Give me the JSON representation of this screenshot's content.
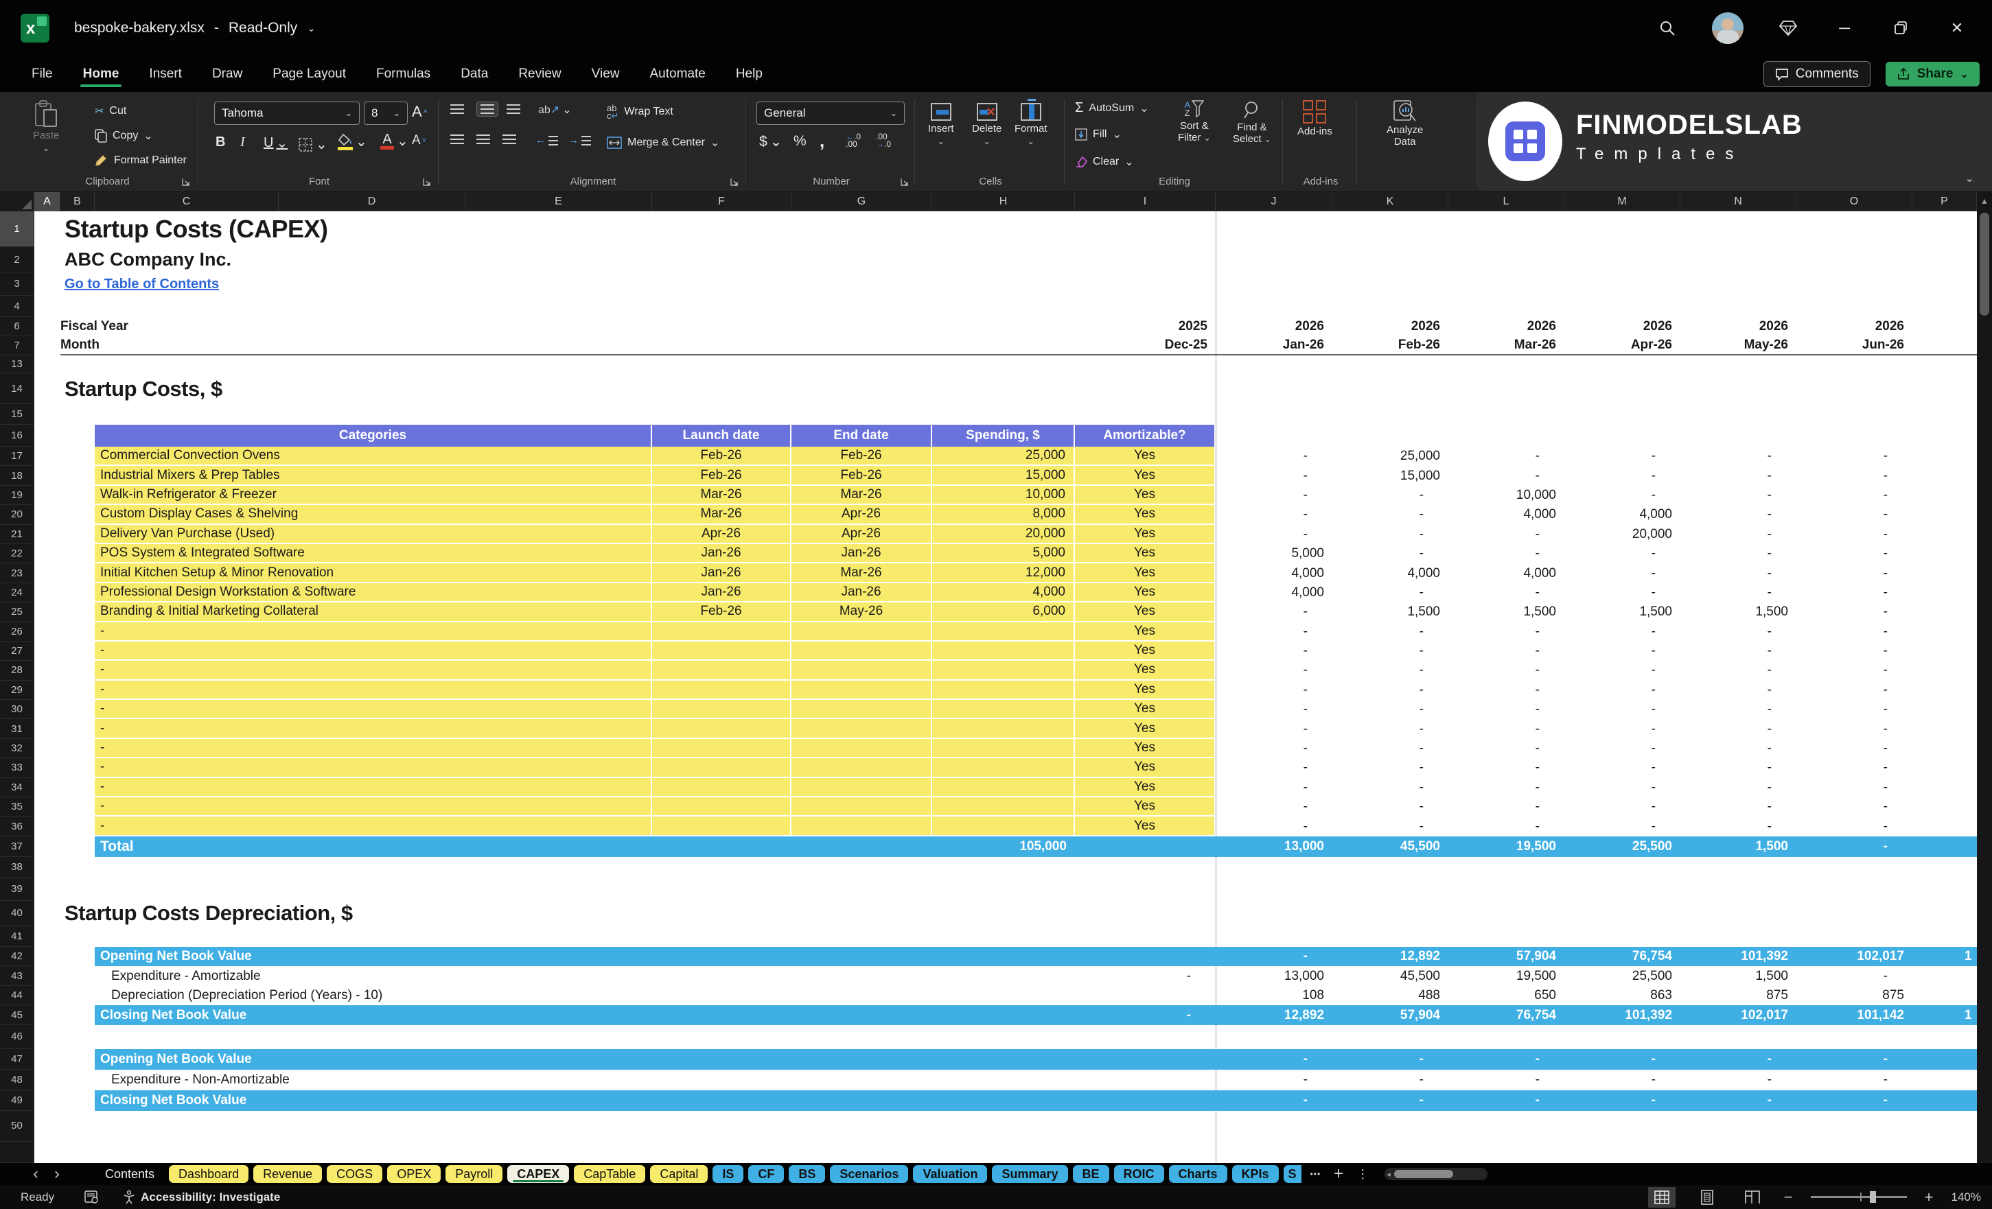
{
  "titlebar": {
    "file": "bespoke-bakery.xlsx",
    "dash": "-",
    "mode": "Read-Only"
  },
  "menu": {
    "tabs": [
      "File",
      "Home",
      "Insert",
      "Draw",
      "Page Layout",
      "Formulas",
      "Data",
      "Review",
      "View",
      "Automate",
      "Help"
    ],
    "active_index": 1,
    "comments": "Comments",
    "share": "Share"
  },
  "ribbon": {
    "clipboard": {
      "paste": "Paste",
      "cut": "Cut",
      "copy": "Copy",
      "format_painter": "Format Painter",
      "label": "Clipboard"
    },
    "font": {
      "family": "Tahoma",
      "size": "8",
      "bold": "B",
      "italic": "I",
      "underline": "U",
      "label": "Font"
    },
    "alignment": {
      "wrap": "Wrap Text",
      "merge": "Merge & Center",
      "label": "Alignment"
    },
    "number": {
      "format": "General",
      "label": "Number"
    },
    "cells": {
      "insert": "Insert",
      "delete": "Delete",
      "format": "Format",
      "label": "Cells"
    },
    "editing": {
      "autosum": "AutoSum",
      "fill": "Fill",
      "clear": "Clear",
      "sort1": "Sort &",
      "sort2": "Filter",
      "find1": "Find &",
      "find2": "Select",
      "label": "Editing"
    },
    "addins": {
      "button": "Add-ins",
      "label": "Add-ins",
      "analyze1": "Analyze",
      "analyze2": "Data"
    },
    "brand": {
      "name": "FINMODELSLAB",
      "sub": "Templates"
    }
  },
  "sheet": {
    "columns": [
      "A",
      "B",
      "C",
      "D",
      "E",
      "F",
      "G",
      "H",
      "I",
      "J",
      "K",
      "L",
      "M",
      "N",
      "O",
      "P"
    ],
    "selected_column": "A",
    "table_headers": [
      "Categories",
      "Launch date",
      "End date",
      "Spending, $",
      "Amortizable?"
    ],
    "grid_rows": [
      {
        "n": "1",
        "type": "title",
        "text": "Startup Costs (CAPEX)",
        "h": 52
      },
      {
        "n": "2",
        "type": "company",
        "text": "ABC Company Inc.",
        "h": 37
      },
      {
        "n": "3",
        "type": "link",
        "text": "Go to Table of Contents",
        "h": 34
      },
      {
        "n": "4",
        "type": "blank",
        "h": 31
      },
      {
        "n": "6",
        "type": "fiscal",
        "label": "Fiscal Year",
        "vals": [
          "2025",
          "2026",
          "2026",
          "2026",
          "2026",
          "2026",
          "2026"
        ],
        "h": 28
      },
      {
        "n": "7",
        "type": "fiscal",
        "label": "Month",
        "vals": [
          "Dec-25",
          "Jan-26",
          "Feb-26",
          "Mar-26",
          "Apr-26",
          "May-26",
          "Jun-26"
        ],
        "h": 28,
        "border": true
      },
      {
        "n": "13",
        "type": "blank",
        "h": 26
      },
      {
        "n": "14",
        "type": "section",
        "text": "Startup Costs, $",
        "h": 45
      },
      {
        "n": "15",
        "type": "blank",
        "h": 30
      },
      {
        "n": "16",
        "type": "thead",
        "h": 32
      },
      {
        "n": "17",
        "type": "item",
        "cat": "Commercial Convection Ovens",
        "launch": "Feb-26",
        "end": "Feb-26",
        "spend": "25,000",
        "amort": "Yes",
        "vals": [
          "-",
          "25,000",
          "-",
          "-",
          "-",
          "-"
        ],
        "h": 28.4
      },
      {
        "n": "18",
        "type": "item",
        "cat": "Industrial Mixers & Prep Tables",
        "launch": "Feb-26",
        "end": "Feb-26",
        "spend": "15,000",
        "amort": "Yes",
        "vals": [
          "-",
          "15,000",
          "-",
          "-",
          "-",
          "-"
        ],
        "h": 28.4
      },
      {
        "n": "19",
        "type": "item",
        "cat": "Walk-in Refrigerator & Freezer",
        "launch": "Mar-26",
        "end": "Mar-26",
        "spend": "10,000",
        "amort": "Yes",
        "vals": [
          "-",
          "-",
          "10,000",
          "-",
          "-",
          "-"
        ],
        "h": 28.4
      },
      {
        "n": "20",
        "type": "item",
        "cat": "Custom Display Cases & Shelving",
        "launch": "Mar-26",
        "end": "Apr-26",
        "spend": "8,000",
        "amort": "Yes",
        "vals": [
          "-",
          "-",
          "4,000",
          "4,000",
          "-",
          "-"
        ],
        "h": 28.4
      },
      {
        "n": "21",
        "type": "item",
        "cat": "Delivery Van Purchase (Used)",
        "launch": "Apr-26",
        "end": "Apr-26",
        "spend": "20,000",
        "amort": "Yes",
        "vals": [
          "-",
          "-",
          "-",
          "20,000",
          "-",
          "-"
        ],
        "h": 28.4
      },
      {
        "n": "22",
        "type": "item",
        "cat": "POS System & Integrated Software",
        "launch": "Jan-26",
        "end": "Jan-26",
        "spend": "5,000",
        "amort": "Yes",
        "vals": [
          "5,000",
          "-",
          "-",
          "-",
          "-",
          "-"
        ],
        "h": 28.4
      },
      {
        "n": "23",
        "type": "item",
        "cat": "Initial Kitchen Setup & Minor Renovation",
        "launch": "Jan-26",
        "end": "Mar-26",
        "spend": "12,000",
        "amort": "Yes",
        "vals": [
          "4,000",
          "4,000",
          "4,000",
          "-",
          "-",
          "-"
        ],
        "h": 28.4
      },
      {
        "n": "24",
        "type": "item",
        "cat": "Professional Design Workstation & Software",
        "launch": "Jan-26",
        "end": "Jan-26",
        "spend": "4,000",
        "amort": "Yes",
        "vals": [
          "4,000",
          "-",
          "-",
          "-",
          "-",
          "-"
        ],
        "h": 28.4
      },
      {
        "n": "25",
        "type": "item",
        "cat": "Branding & Initial Marketing Collateral",
        "launch": "Feb-26",
        "end": "May-26",
        "spend": "6,000",
        "amort": "Yes",
        "vals": [
          "-",
          "1,500",
          "1,500",
          "1,500",
          "1,500",
          "-"
        ],
        "h": 28.4
      },
      {
        "n": "26",
        "type": "item",
        "cat": "-",
        "launch": "",
        "end": "",
        "spend": "",
        "amort": "Yes",
        "vals": [
          "-",
          "-",
          "-",
          "-",
          "-",
          "-"
        ],
        "h": 28.4
      },
      {
        "n": "27",
        "type": "item",
        "cat": "-",
        "launch": "",
        "end": "",
        "spend": "",
        "amort": "Yes",
        "vals": [
          "-",
          "-",
          "-",
          "-",
          "-",
          "-"
        ],
        "h": 28.4
      },
      {
        "n": "28",
        "type": "item",
        "cat": "-",
        "launch": "",
        "end": "",
        "spend": "",
        "amort": "Yes",
        "vals": [
          "-",
          "-",
          "-",
          "-",
          "-",
          "-"
        ],
        "h": 28.4
      },
      {
        "n": "29",
        "type": "item",
        "cat": "-",
        "launch": "",
        "end": "",
        "spend": "",
        "amort": "Yes",
        "vals": [
          "-",
          "-",
          "-",
          "-",
          "-",
          "-"
        ],
        "h": 28.4
      },
      {
        "n": "30",
        "type": "item",
        "cat": "-",
        "launch": "",
        "end": "",
        "spend": "",
        "amort": "Yes",
        "vals": [
          "-",
          "-",
          "-",
          "-",
          "-",
          "-"
        ],
        "h": 28.4
      },
      {
        "n": "31",
        "type": "item",
        "cat": "-",
        "launch": "",
        "end": "",
        "spend": "",
        "amort": "Yes",
        "vals": [
          "-",
          "-",
          "-",
          "-",
          "-",
          "-"
        ],
        "h": 28.4
      },
      {
        "n": "32",
        "type": "item",
        "cat": "-",
        "launch": "",
        "end": "",
        "spend": "",
        "amort": "Yes",
        "vals": [
          "-",
          "-",
          "-",
          "-",
          "-",
          "-"
        ],
        "h": 28.4
      },
      {
        "n": "33",
        "type": "item",
        "cat": "-",
        "launch": "",
        "end": "",
        "spend": "",
        "amort": "Yes",
        "vals": [
          "-",
          "-",
          "-",
          "-",
          "-",
          "-"
        ],
        "h": 28.4
      },
      {
        "n": "34",
        "type": "item",
        "cat": "-",
        "launch": "",
        "end": "",
        "spend": "",
        "amort": "Yes",
        "vals": [
          "-",
          "-",
          "-",
          "-",
          "-",
          "-"
        ],
        "h": 28.4
      },
      {
        "n": "35",
        "type": "item",
        "cat": "-",
        "launch": "",
        "end": "",
        "spend": "",
        "amort": "Yes",
        "vals": [
          "-",
          "-",
          "-",
          "-",
          "-",
          "-"
        ],
        "h": 28.4
      },
      {
        "n": "36",
        "type": "item",
        "cat": "-",
        "launch": "",
        "end": "",
        "spend": "",
        "amort": "Yes",
        "vals": [
          "-",
          "-",
          "-",
          "-",
          "-",
          "-"
        ],
        "h": 28.4
      },
      {
        "n": "37",
        "type": "total",
        "label": "Total",
        "spend": "105,000",
        "vals": [
          "13,000",
          "45,500",
          "19,500",
          "25,500",
          "1,500",
          "-"
        ],
        "h": 30
      },
      {
        "n": "38",
        "type": "blank",
        "h": 30
      },
      {
        "n": "39",
        "type": "blank",
        "h": 34
      },
      {
        "n": "40",
        "type": "section",
        "text": "Startup Costs Depreciation, $",
        "h": 37
      },
      {
        "n": "41",
        "type": "blank",
        "h": 30
      },
      {
        "n": "42",
        "type": "dep",
        "style": "blue",
        "label": "Opening Net Book Value",
        "i": "",
        "vals": [
          "-",
          "12,892",
          "57,904",
          "76,754",
          "101,392",
          "102,017"
        ],
        "p": "1",
        "h": 28.5
      },
      {
        "n": "43",
        "type": "dep",
        "style": "plain",
        "label": "Expenditure - Amortizable",
        "i": "-",
        "vals": [
          "13,000",
          "45,500",
          "19,500",
          "25,500",
          "1,500",
          "-"
        ],
        "p": "",
        "h": 28.5
      },
      {
        "n": "44",
        "type": "dep",
        "style": "plain",
        "label": "Depreciation (Depreciation Period (Years) - 10)",
        "i": "",
        "vals": [
          "108",
          "488",
          "650",
          "863",
          "875",
          "875"
        ],
        "p": "",
        "h": 28.5
      },
      {
        "n": "45",
        "type": "dep",
        "style": "blue",
        "label": "Closing Net Book Value",
        "i": "-",
        "vals": [
          "12,892",
          "57,904",
          "76,754",
          "101,392",
          "102,017",
          "101,142"
        ],
        "p": "1",
        "h": 28.5
      },
      {
        "n": "46",
        "type": "blank",
        "h": 35
      },
      {
        "n": "47",
        "type": "dep",
        "style": "blue",
        "label": "Opening Net Book Value",
        "i": "",
        "vals": [
          "-",
          "-",
          "-",
          "-",
          "-",
          "-"
        ],
        "p": "",
        "h": 30
      },
      {
        "n": "48",
        "type": "dep",
        "style": "plain",
        "label": "Expenditure - Non-Amortizable",
        "i": "",
        "vals": [
          "-",
          "-",
          "-",
          "-",
          "-",
          "-"
        ],
        "p": "",
        "h": 30
      },
      {
        "n": "49",
        "type": "dep",
        "style": "blue",
        "label": "Closing Net Book Value",
        "i": "",
        "vals": [
          "-",
          "-",
          "-",
          "-",
          "-",
          "-"
        ],
        "p": "",
        "h": 30
      },
      {
        "n": "50",
        "type": "blank",
        "h": 45
      },
      {
        "n": "",
        "type": "blank",
        "h": 31
      }
    ]
  },
  "sheet_tabs": {
    "nav_left": "‹",
    "nav_right": "›",
    "more": "•••",
    "add": "+",
    "menu": "⋮",
    "items": [
      {
        "label": "Contents",
        "color": "plain"
      },
      {
        "label": "Dashboard",
        "color": "yellow"
      },
      {
        "label": "Revenue",
        "color": "yellow"
      },
      {
        "label": "COGS",
        "color": "yellow"
      },
      {
        "label": "OPEX",
        "color": "yellow"
      },
      {
        "label": "Payroll",
        "color": "yellow"
      },
      {
        "label": "CAPEX",
        "color": "active"
      },
      {
        "label": "CapTable",
        "color": "yellow"
      },
      {
        "label": "Capital",
        "color": "yellow"
      },
      {
        "label": "IS",
        "color": "blue"
      },
      {
        "label": "CF",
        "color": "blue"
      },
      {
        "label": "BS",
        "color": "blue"
      },
      {
        "label": "Scenarios",
        "color": "blue"
      },
      {
        "label": "Valuation",
        "color": "blue"
      },
      {
        "label": "Summary",
        "color": "blue"
      },
      {
        "label": "BE",
        "color": "blue"
      },
      {
        "label": "ROIC",
        "color": "blue"
      },
      {
        "label": "Charts",
        "color": "blue"
      },
      {
        "label": "KPIs",
        "color": "blue"
      },
      {
        "label": "S",
        "color": "blue",
        "cut": true
      }
    ]
  },
  "statusbar": {
    "ready": "Ready",
    "accessibility": "Accessibility: Investigate",
    "zoom": "140%"
  }
}
